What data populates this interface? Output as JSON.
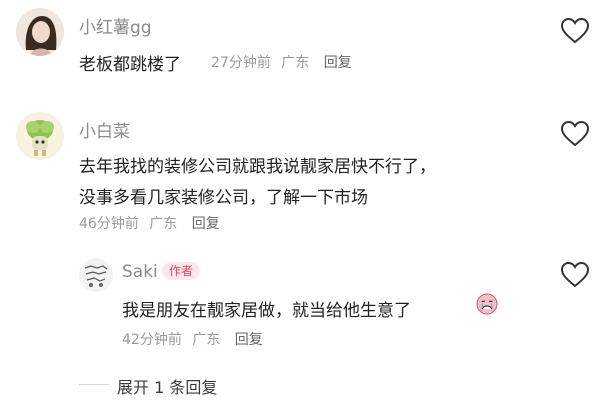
{
  "comments": [
    {
      "username": "小红薯gg",
      "text": "老板都跳楼了",
      "time": "27分钟前",
      "location": "广东",
      "reply_label": "回复",
      "avatar_icon": "woman-portrait-avatar"
    },
    {
      "username": "小白菜",
      "text_line1": "去年我找的装修公司就跟我说靓家居快不行了，",
      "text_line2": "没事多看几家装修公司，了解一下市场",
      "time": "46分钟前",
      "location": "广东",
      "reply_label": "回复",
      "avatar_icon": "cabbage-cartoon-avatar"
    }
  ],
  "reply": {
    "username": "Saki",
    "badge": "作者",
    "text": "我是朋友在靓家居做，就当给他生意了",
    "emoji_icon": "crying-face-emoji",
    "time": "42分钟前",
    "location": "广东",
    "reply_label": "回复",
    "avatar_icon": "sketch-doodle-avatar"
  },
  "expand_label": "展开 1 条回复",
  "colors": {
    "author_badge_bg": "#fde7ea",
    "author_badge_text": "#e0455a"
  }
}
